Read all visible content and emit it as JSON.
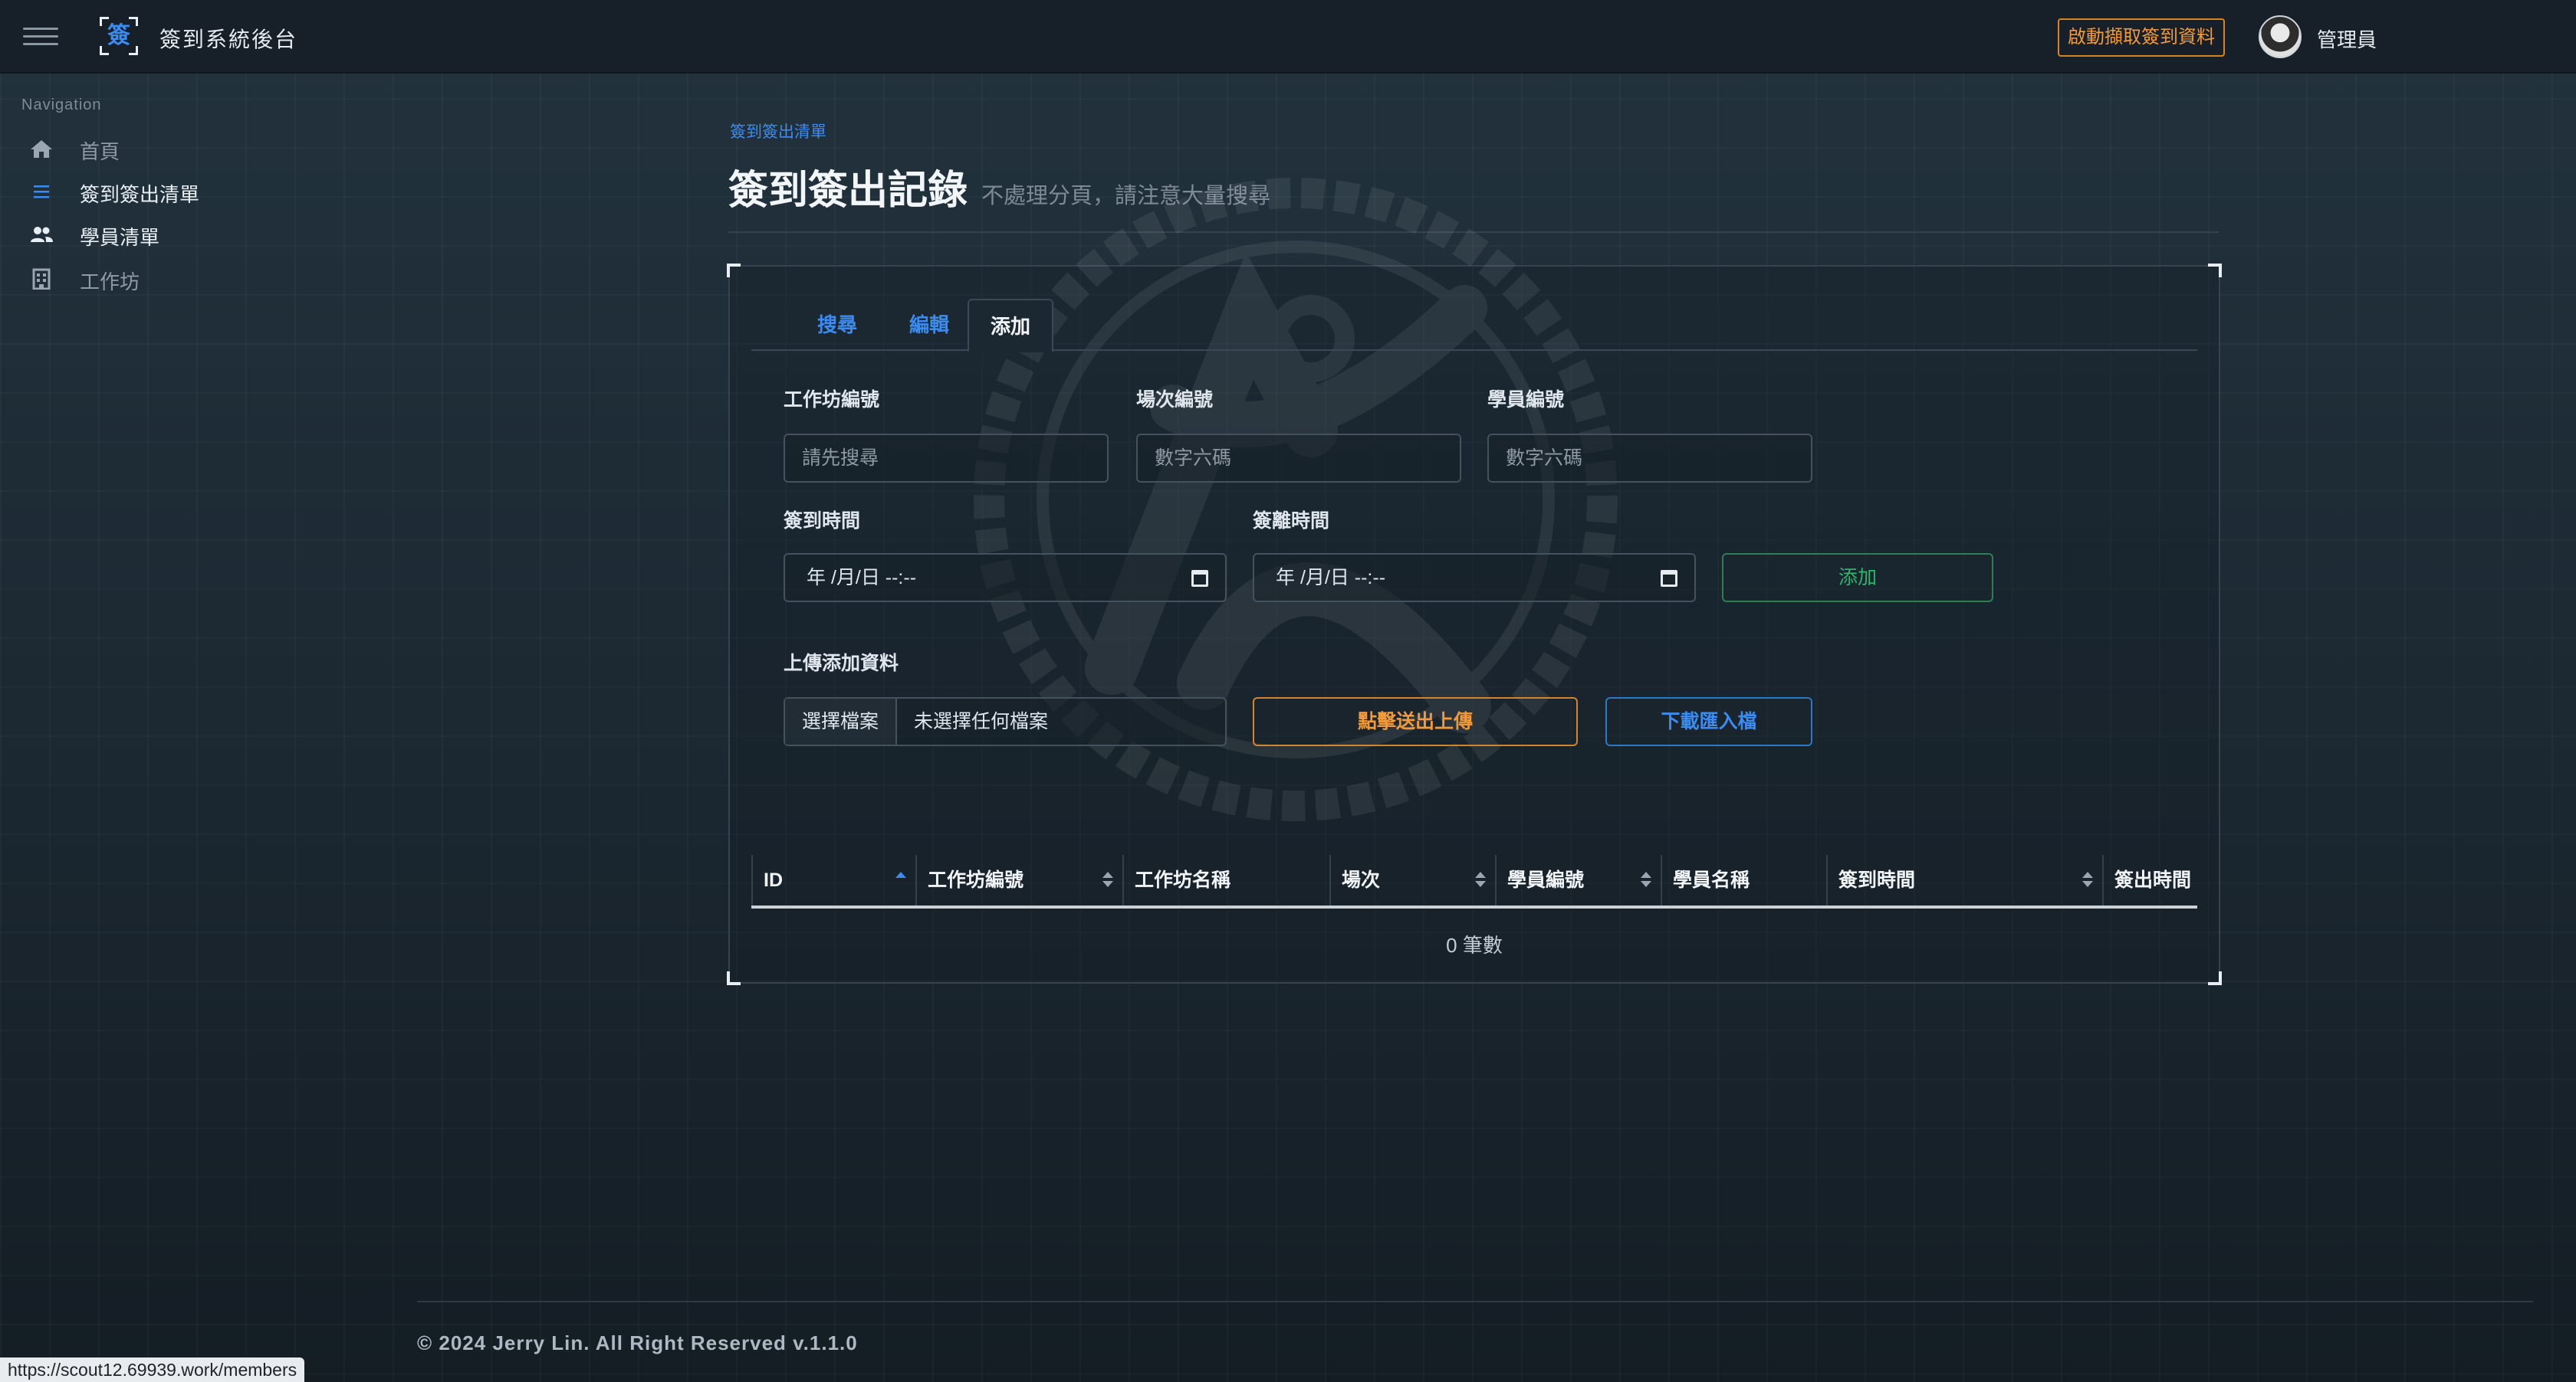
{
  "app": {
    "title": "簽到系統後台",
    "logo_char": "簽"
  },
  "header": {
    "fetch_button": "啟動擷取簽到資料",
    "user_name": "管理員"
  },
  "nav": {
    "heading": "Navigation",
    "items": [
      {
        "label": "首頁",
        "icon": "home-icon"
      },
      {
        "label": "簽到簽出清單",
        "icon": "list-icon"
      },
      {
        "label": "學員清單",
        "icon": "users-icon"
      },
      {
        "label": "工作坊",
        "icon": "building-icon"
      }
    ]
  },
  "page": {
    "breadcrumb": "簽到簽出清單",
    "title": "簽到簽出記錄",
    "subtitle": "不處理分頁，請注意大量搜尋"
  },
  "tabs": [
    {
      "label": "搜尋"
    },
    {
      "label": "編輯"
    },
    {
      "label": "添加"
    }
  ],
  "form": {
    "workshop_id": {
      "label": "工作坊編號",
      "placeholder": "請先搜尋"
    },
    "session_id": {
      "label": "場次編號",
      "placeholder": "數字六碼"
    },
    "student_id": {
      "label": "學員編號",
      "placeholder": "數字六碼"
    },
    "checkin_time": {
      "label": "簽到時間",
      "value": "年 /月/日 --:--"
    },
    "checkout_time": {
      "label": "簽離時間",
      "value": "年 /月/日 --:--"
    },
    "add_button": "添加",
    "upload_label": "上傳添加資料",
    "file_button": "選擇檔案",
    "file_status": "未選擇任何檔案",
    "upload_button": "點擊送出上傳",
    "download_button": "下載匯入檔"
  },
  "table": {
    "columns": [
      "ID",
      "工作坊編號",
      "工作坊名稱",
      "場次",
      "學員編號",
      "學員名稱",
      "簽到時間",
      "簽出時間"
    ],
    "rows": [],
    "count_text": "0 筆數"
  },
  "footer": {
    "copyright": "© 2024 Jerry Lin. All Right Reserved v.1.1.0"
  },
  "status_bar": {
    "url": "https://scout12.69939.work/members"
  },
  "colors": {
    "accent": "#3a8cf0",
    "warning": "#f29a39",
    "success": "#2fb46c",
    "background": "#1b2731"
  }
}
